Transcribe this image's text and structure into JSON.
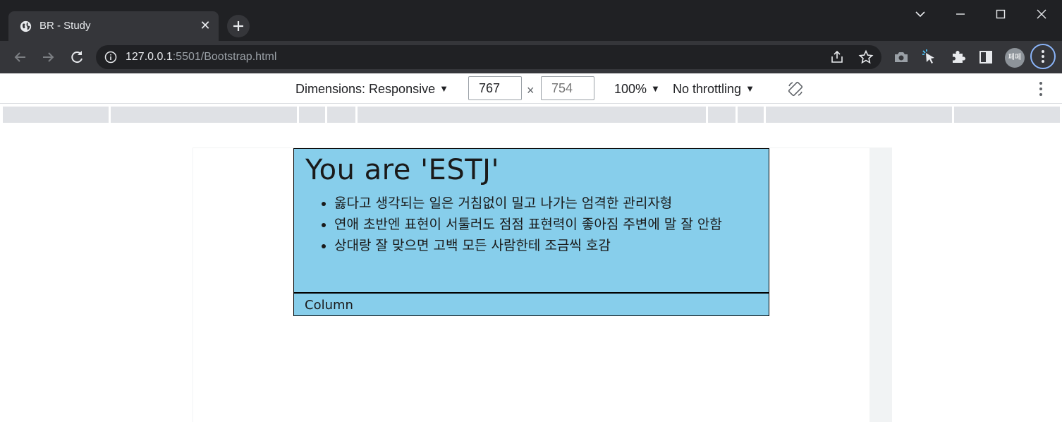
{
  "browser": {
    "tab_title": "BR - Study",
    "url_host": "127.0.0.1",
    "url_rest": ":5501/Bootstrap.html",
    "profile_label": "페페"
  },
  "devtools": {
    "dimensions_label": "Dimensions: Responsive",
    "width_value": "767",
    "height_placeholder": "754",
    "zoom_label": "100%",
    "throttle_label": "No throttling"
  },
  "page": {
    "heading": "You are 'ESTJ'",
    "items": [
      "옳다고 생각되는 일은 거침없이 밀고 나가는 엄격한 관리자형",
      "연애 초반엔 표현이 서툴러도 점점 표현력이 좋아짐 주변에 말 잘 안함",
      "상대랑 잘 맞으면 고백 모든 사람한테 조금씩 호감"
    ],
    "footer": "Column"
  },
  "colors": {
    "card_bg": "#87ceeb",
    "chrome_dark": "#202124",
    "toolbar": "#35363a"
  }
}
